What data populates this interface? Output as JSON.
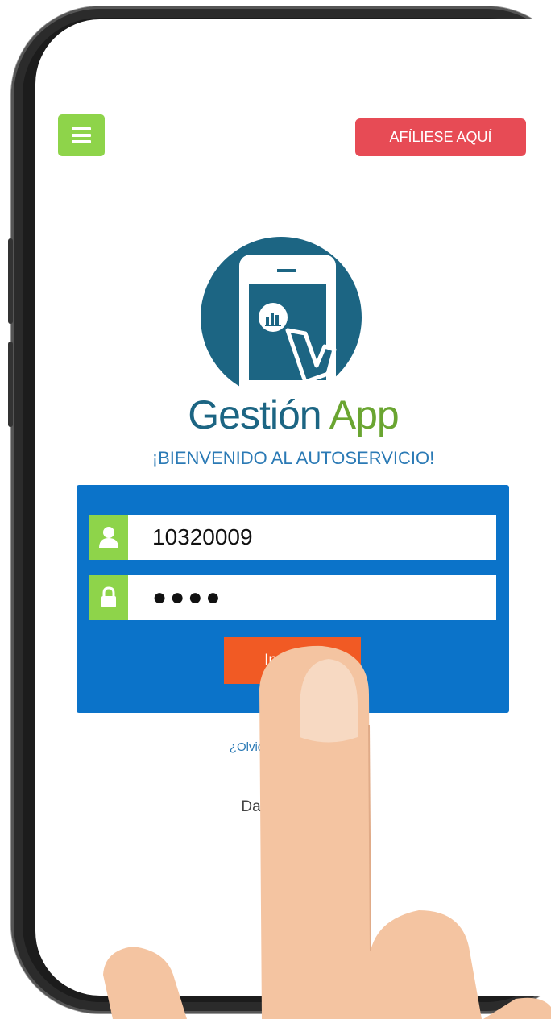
{
  "header": {
    "menu_icon": "hamburger-menu-icon",
    "affiliate_label": "AFÍLIESE AQUÍ"
  },
  "brand": {
    "name_part1": "Gestión",
    "name_part2": "App",
    "primary_color": "#1c6583",
    "accent_color": "#6aa531"
  },
  "welcome_text": "¡BIENVENIDO AL AUTOSERVICIO!",
  "login": {
    "username_icon": "user-icon",
    "username_value": "10320009",
    "password_icon": "lock-icon",
    "password_value": "●●●●",
    "submit_label": "Ingresar"
  },
  "footer": {
    "forgot_link": "¿Olvidó su contraseña?",
    "theme_toggle_label": "Dark Theme",
    "theme_icon": "moon-icon"
  },
  "colors": {
    "panel_bg": "#0b73c9",
    "field_icon_bg": "#8ed44a",
    "affiliate_bg": "#e74b55",
    "submit_bg": "#f15a24"
  }
}
